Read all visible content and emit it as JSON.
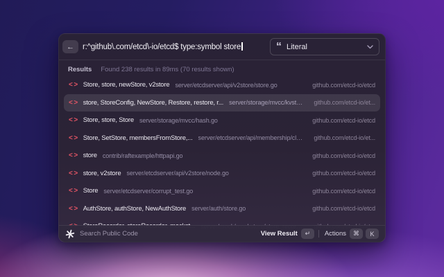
{
  "icons": {
    "back": "←",
    "quote": "“",
    "code": "<>"
  },
  "search": {
    "query": "r:^github\\.com/etcd\\-io/etcd$ type:symbol store",
    "pattern_dropdown": {
      "label": "Literal"
    }
  },
  "results_header": {
    "label": "Results",
    "summary": "Found 238 results in 89ms (70 results shown)"
  },
  "results": [
    {
      "title": "Store, store, newStore, v2store",
      "path": "server/etcdserver/api/v2store/store.go",
      "repo": "github.com/etcd-io/etcd"
    },
    {
      "title": "store, StoreConfig, NewStore, Restore, restore, r...",
      "path": "server/storage/mvcc/kvstore.go",
      "repo": "github.com/etcd-io/et..."
    },
    {
      "title": "Store, store, Store",
      "path": "server/storage/mvcc/hash.go",
      "repo": "github.com/etcd-io/etcd"
    },
    {
      "title": "Store, SetStore, membersFromStore,...",
      "path": "server/etcdserver/api/membership/cluste...",
      "repo": "github.com/etcd-io/et..."
    },
    {
      "title": "store",
      "path": "contrib/raftexample/httpapi.go",
      "repo": "github.com/etcd-io/etcd"
    },
    {
      "title": "store, v2store",
      "path": "server/etcdserver/api/v2store/node.go",
      "repo": "github.com/etcd-io/etcd"
    },
    {
      "title": "Store",
      "path": "server/etcdserver/corrupt_test.go",
      "repo": "github.com/etcd-io/etcd"
    },
    {
      "title": "AuthStore, authStore, NewAuthStore",
      "path": "server/auth/store.go",
      "repo": "github.com/etcd-io/etcd"
    },
    {
      "title": "StoreRecorder, storeRecorder, mockst...",
      "path": "server/mock/mockstore/store_recorder.go",
      "repo": "github.com/etcd-io/et..."
    }
  ],
  "footer": {
    "app_name": "Search Public Code",
    "primary_action": "View Result",
    "primary_key": "↵",
    "secondary_action": "Actions",
    "secondary_keys": [
      "⌘",
      "K"
    ]
  },
  "colors": {
    "symbol_icon": "#e65565",
    "modal_bg": "#2b2336",
    "selected_row_bg": "rgba(255,255,255,0.10)",
    "wallpaper_top_left": "#211b57",
    "wallpaper_top_right": "#5e23a2",
    "wallpaper_glow": "#f0bde4"
  }
}
